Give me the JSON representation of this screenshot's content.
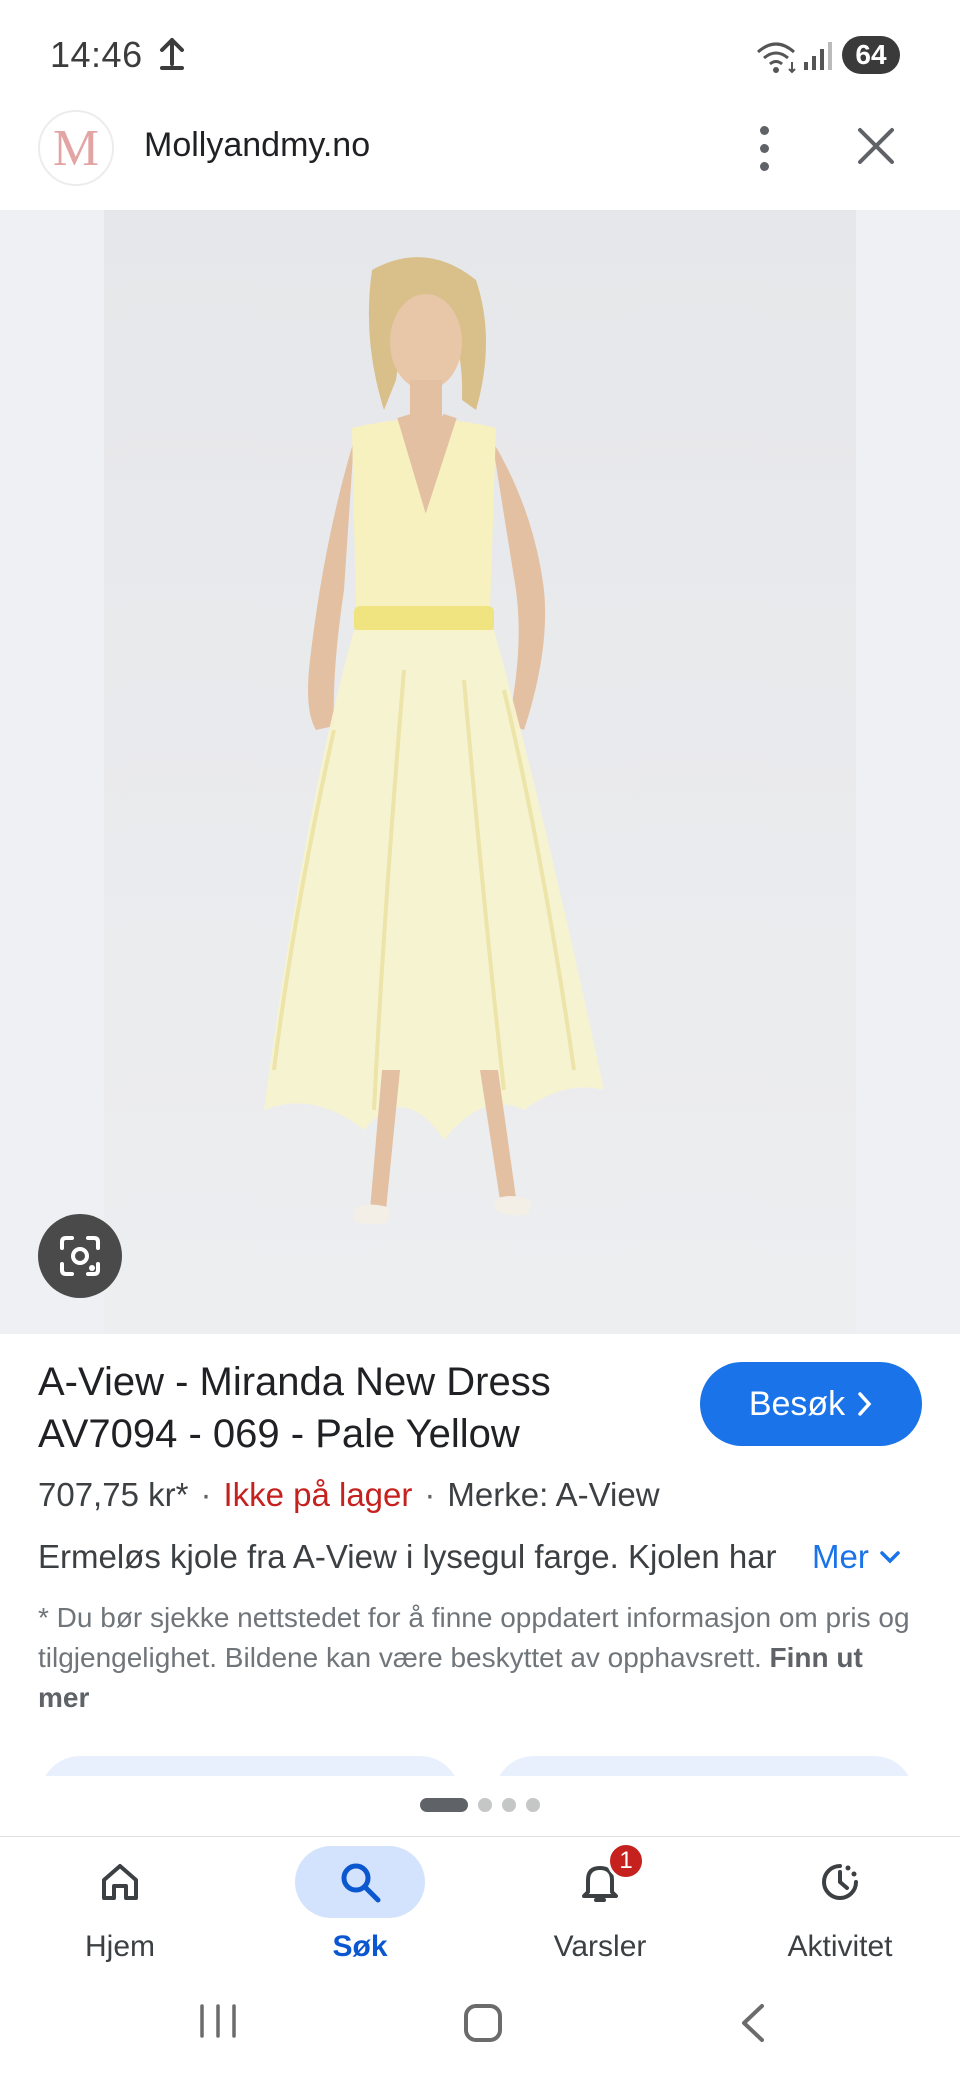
{
  "status_bar": {
    "time": "14:46",
    "battery": "64"
  },
  "header": {
    "logo_letter": "M",
    "site_name": "Mollyandmy.no"
  },
  "product": {
    "title_line1": "A-View - Miranda New Dress",
    "title_line2": "AV7094 - 069 - Pale Yellow",
    "visit_label": "Besøk",
    "price": "707,75 kr*",
    "stock": "Ikke på lager",
    "brand": "Merke: A-View",
    "description": "Ermeløs kjole fra A-View i lysegul farge. Kjolen har",
    "more_label": "Mer",
    "disclaimer": "* Du bør sjekke nettstedet for å finne oppdatert informasjon om pris og tilgjengelighet. Bildene kan være beskyttet av opphavsrett.",
    "learn_more": "Finn ut mer"
  },
  "carousel": {
    "dot_count": 4,
    "active_index": 0
  },
  "bottom_nav": {
    "items": [
      {
        "label": "Hjem",
        "icon": "home-icon"
      },
      {
        "label": "Søk",
        "icon": "search-icon",
        "active": true
      },
      {
        "label": "Varsler",
        "icon": "bell-icon",
        "badge": "1"
      },
      {
        "label": "Aktivitet",
        "icon": "activity-icon"
      }
    ]
  },
  "colors": {
    "accent": "#1a73e8",
    "stock_red": "#c5221f",
    "active_pill": "#d3e3fd",
    "dress_yellow": "#f6f1bf"
  }
}
